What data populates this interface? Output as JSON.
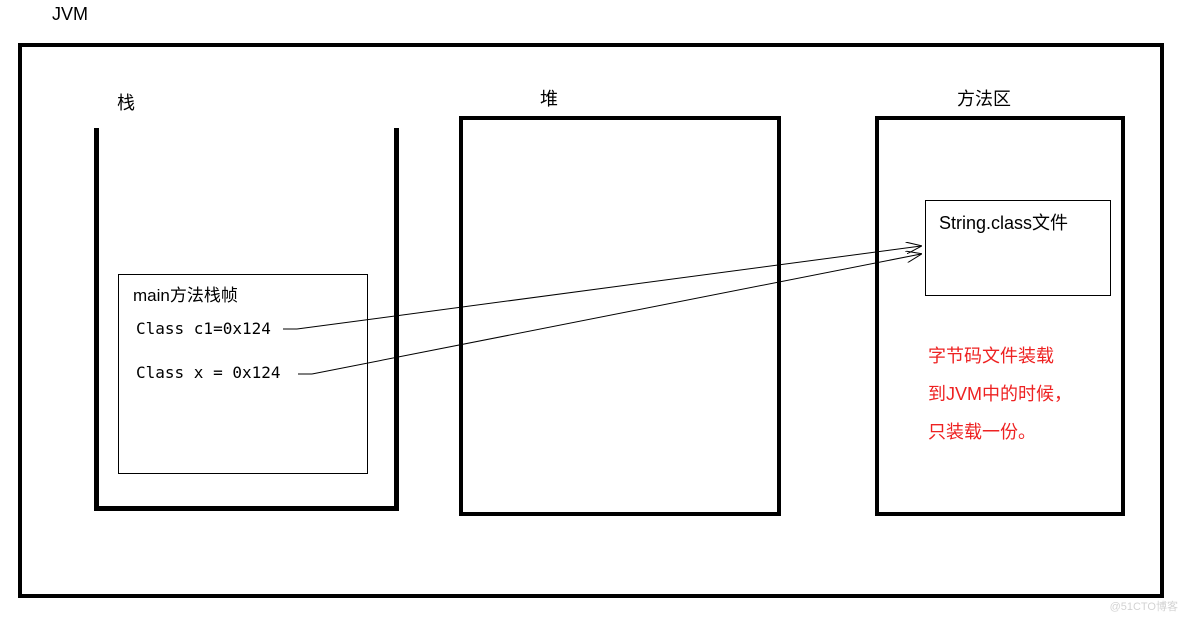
{
  "title": "JVM",
  "stack": {
    "label": "栈",
    "frame_title": "main方法栈帧",
    "line1": "Class c1=0x124",
    "line2": "Class x = 0x124"
  },
  "heap": {
    "label": "堆"
  },
  "method_area": {
    "label": "方法区",
    "classfile": "String.class文件",
    "note_line1": "字节码文件装载",
    "note_line2": "到JVM中的时候，",
    "note_line3": "只装载一份。"
  },
  "watermark": "@51CTO博客"
}
